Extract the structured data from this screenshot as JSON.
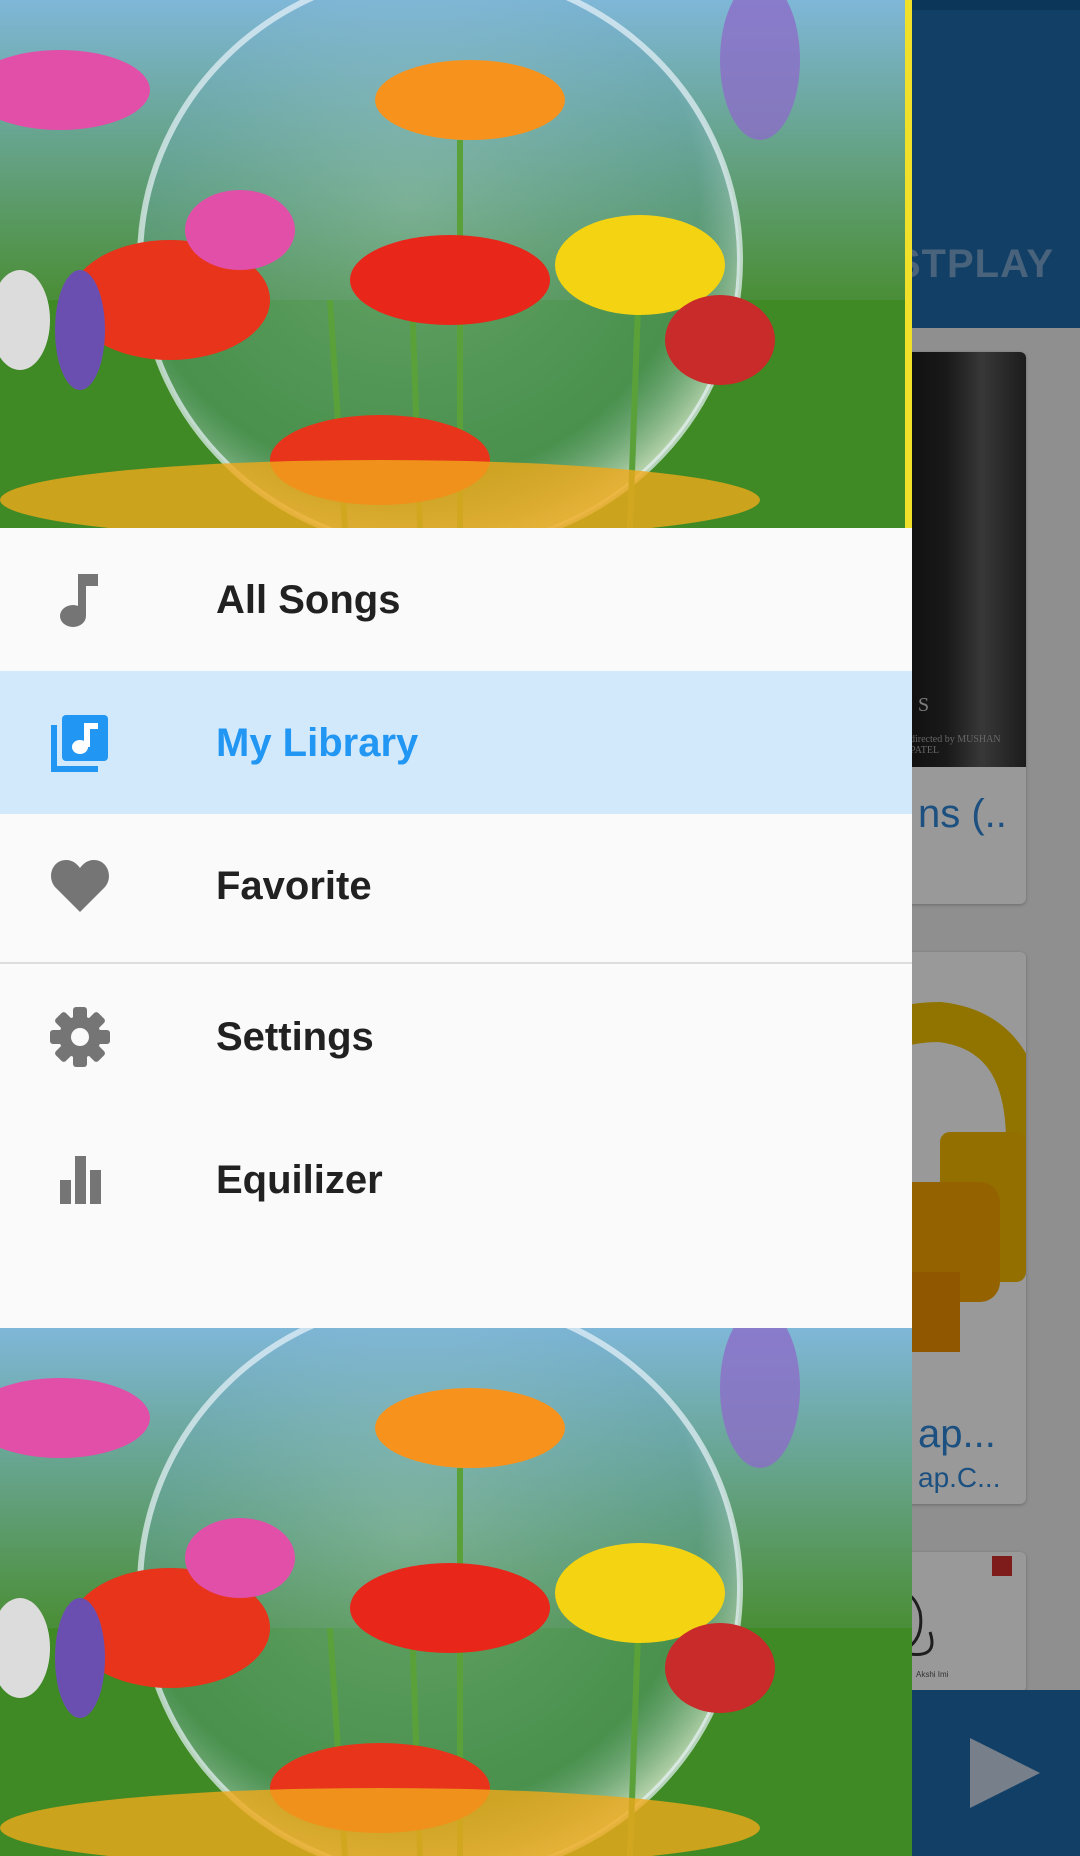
{
  "background_app": {
    "tab_label": "STPLAY",
    "cards": [
      {
        "title": "ns (..",
        "art_text": "S",
        "art_credit": "directed by MUSHAN PATEL"
      },
      {
        "title": "ap...",
        "subtitle": "ap.C..."
      },
      {
        "caption": "Akshi Imi"
      }
    ]
  },
  "drawer": {
    "menu": [
      {
        "id": "all-songs",
        "label": "All Songs",
        "icon": "music-note-icon",
        "selected": false
      },
      {
        "id": "my-library",
        "label": "My Library",
        "icon": "library-music-icon",
        "selected": true
      },
      {
        "id": "favorite",
        "label": "Favorite",
        "icon": "heart-icon",
        "selected": false
      },
      {
        "id": "settings",
        "label": "Settings",
        "icon": "gear-icon",
        "selected": false
      },
      {
        "id": "equalizer",
        "label": "Equilizer",
        "icon": "equalizer-icon",
        "selected": false
      }
    ]
  },
  "colors": {
    "primary": "#1f6aa8",
    "accent": "#2196f3",
    "selected_bg": "#d2e9fc",
    "icon": "#757575"
  }
}
